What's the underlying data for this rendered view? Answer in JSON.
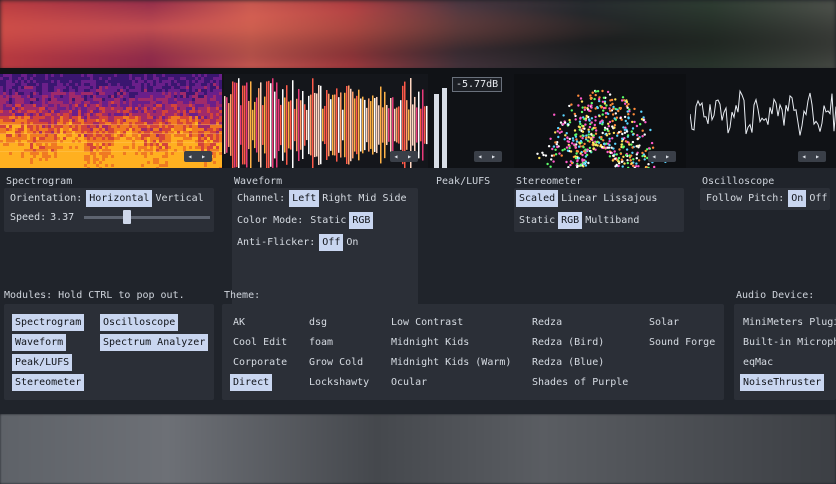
{
  "visualizers": {
    "peak_readout": "-5.77dB",
    "nav_arrows": "◂ ▸"
  },
  "spectrogram": {
    "title": "Spectrogram",
    "orientation_label": "Orientation:",
    "orientation_options": [
      "Horizontal",
      "Vertical"
    ],
    "orientation_selected": "Horizontal",
    "speed_label": "Speed:",
    "speed_value": "3.37",
    "speed_fraction": 0.33
  },
  "waveform": {
    "title": "Waveform",
    "channel_label": "Channel:",
    "channel_options": [
      "Left",
      "Right",
      "Mid",
      "Side"
    ],
    "channel_selected": "Left",
    "color_mode_label": "Color Mode:",
    "color_mode_options": [
      "Static",
      "RGB"
    ],
    "color_mode_selected": "RGB",
    "anti_flicker_label": "Anti-Flicker:",
    "anti_flicker_options": [
      "Off",
      "On"
    ],
    "anti_flicker_selected": "Off"
  },
  "peak": {
    "title": "Peak/LUFS"
  },
  "stereometer": {
    "title": "Stereometer",
    "mode_options": [
      "Scaled",
      "Linear",
      "Lissajous"
    ],
    "mode_selected": "Scaled",
    "color_options": [
      "Static",
      "RGB",
      "Multiband"
    ],
    "color_selected": "RGB"
  },
  "oscilloscope": {
    "title": "Oscilloscope",
    "follow_pitch_label": "Follow Pitch:",
    "follow_pitch_options": [
      "On",
      "Off"
    ],
    "follow_pitch_selected": "On"
  },
  "modules": {
    "title": "Modules: Hold CTRL to pop out.",
    "items": [
      "Spectrogram",
      "Waveform",
      "Peak/LUFS",
      "Stereometer",
      "Oscilloscope",
      "Spectrum Analyzer"
    ]
  },
  "theme": {
    "title": "Theme:",
    "items": [
      "AK",
      "Cool Edit",
      "Corporate",
      "Direct",
      "dsg",
      "foam",
      "Grow Cold",
      "Lockshawty",
      "Low Contrast",
      "Midnight Kids",
      "Midnight Kids (Warm)",
      "Ocular",
      "Redza",
      "Redza (Bird)",
      "Redza (Blue)",
      "Shades of Purple",
      "Solar",
      "Sound Forge"
    ],
    "selected": "Direct"
  },
  "audio_device": {
    "title": "Audio Device:",
    "items": [
      "MiniMeters Plugi",
      "Built-in Microph",
      "eqMac",
      "NoiseThruster"
    ],
    "selected": "NoiseThruster"
  },
  "colors": {
    "accent": "#c9d6f0",
    "panel": "#2b2f37",
    "background": "#20242b"
  }
}
